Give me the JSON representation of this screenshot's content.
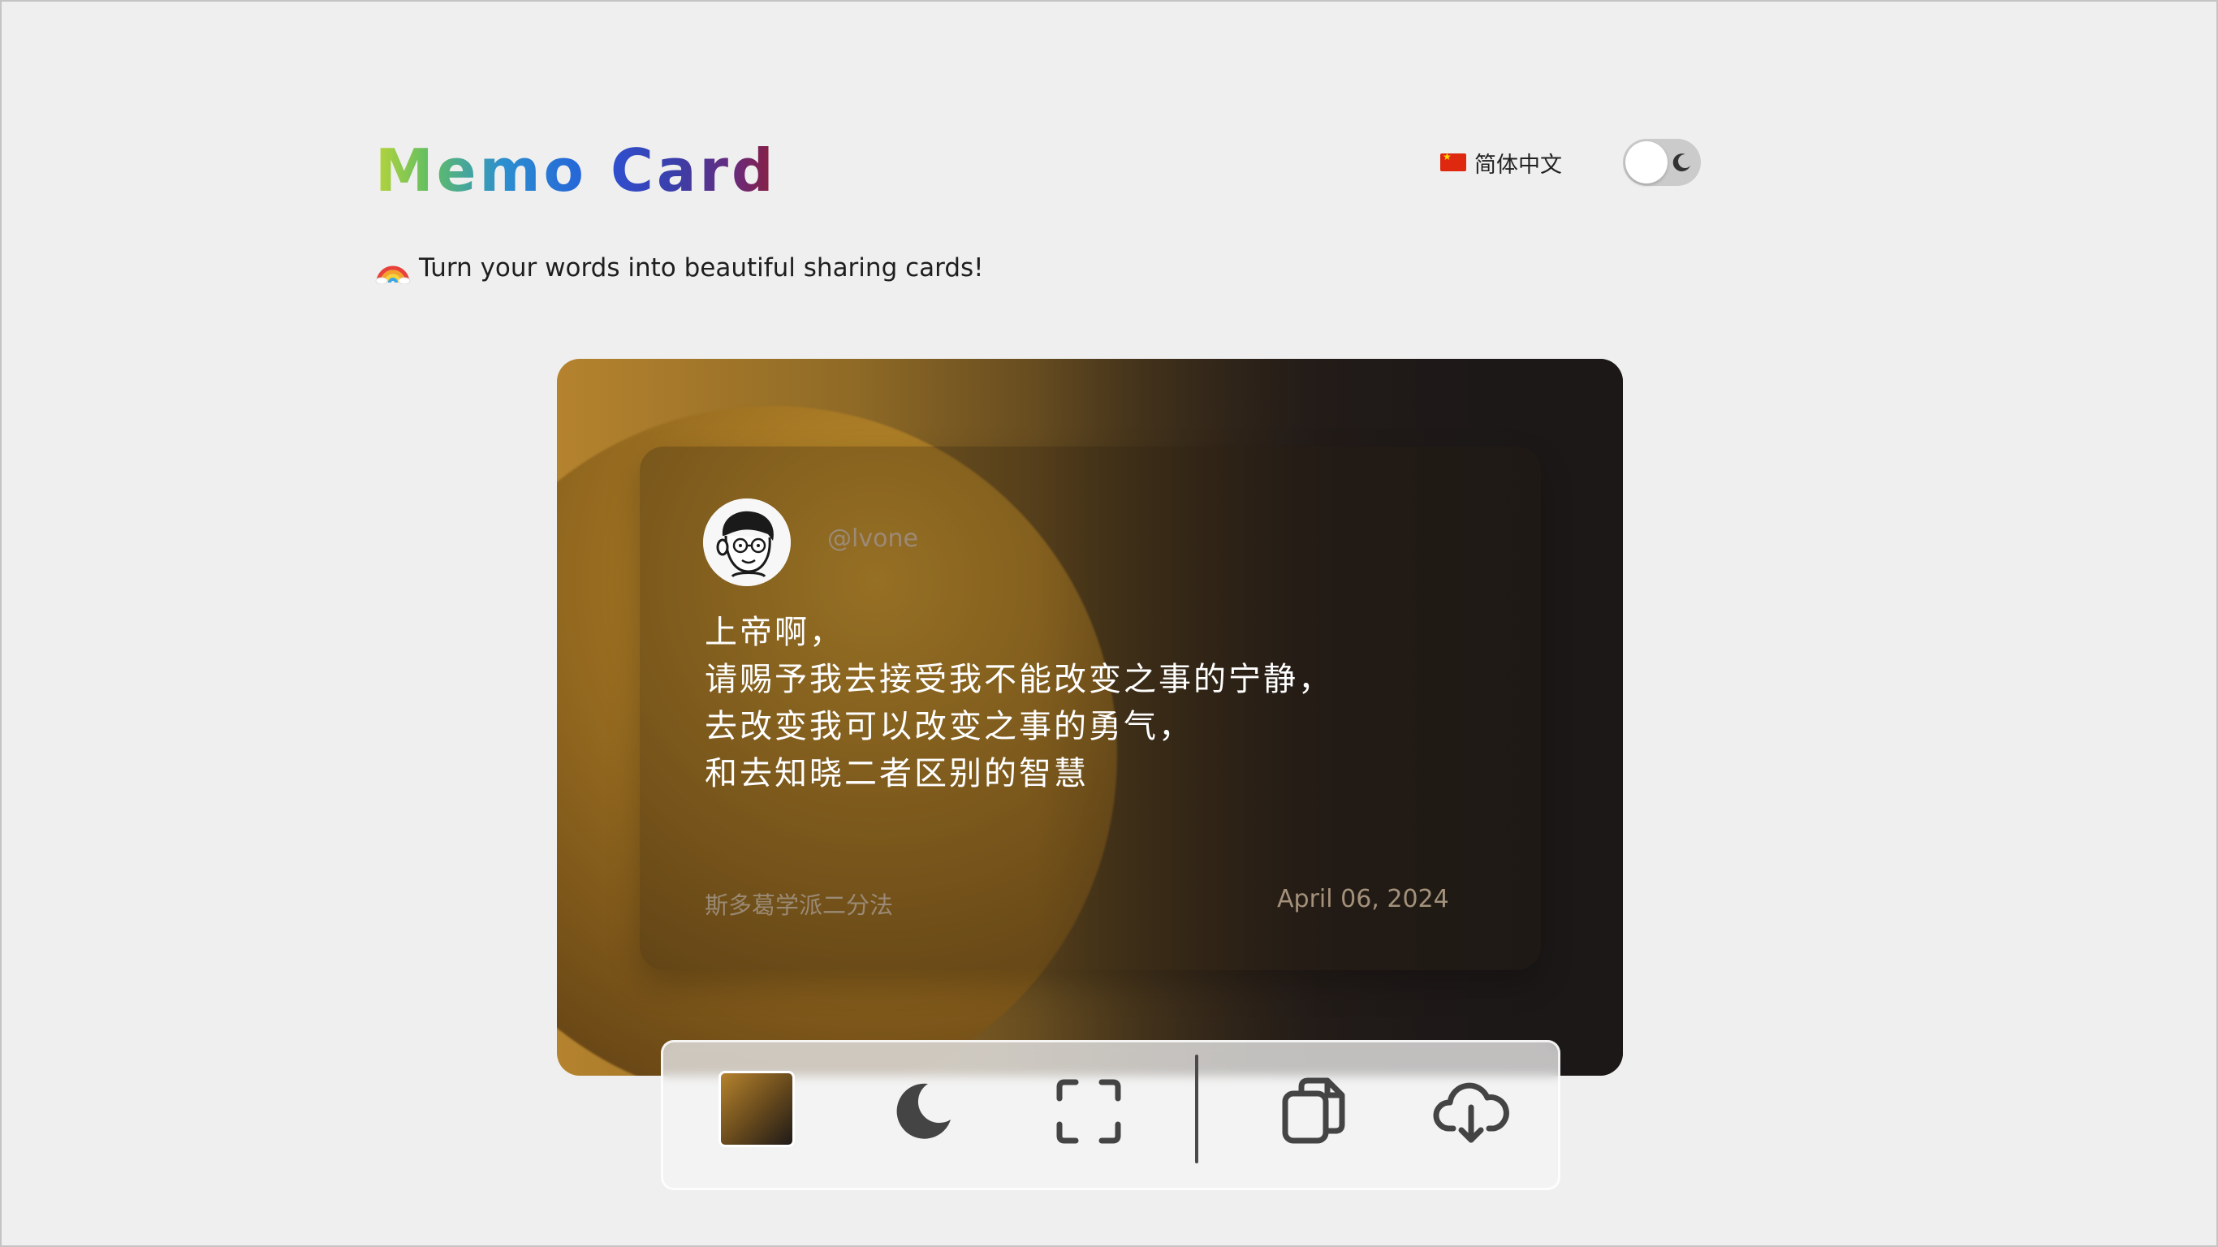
{
  "header": {
    "title_part1": "Memo",
    "title_part2": "Card",
    "language_label": "简体中文",
    "theme_toggle_state": "off",
    "subtitle": "Turn your words into beautiful sharing cards!"
  },
  "card": {
    "handle": "@lvone",
    "lines": [
      "上帝啊，",
      "请赐予我去接受我不能改变之事的宁静，",
      "去改变我可以改变之事的勇气，",
      "和去知晓二者区别的智慧"
    ],
    "source": "斯多葛学派二分法",
    "date": "April 06, 2024",
    "gradient_colors": [
      "#b5832e",
      "#1c1818"
    ]
  },
  "toolbar": {
    "items": [
      "color-swatch",
      "moon-icon",
      "fullscreen-icon",
      "copy-icon",
      "download-cloud-icon"
    ]
  },
  "colors": {
    "background": "#efefef",
    "text_primary": "#1e1e1e"
  }
}
